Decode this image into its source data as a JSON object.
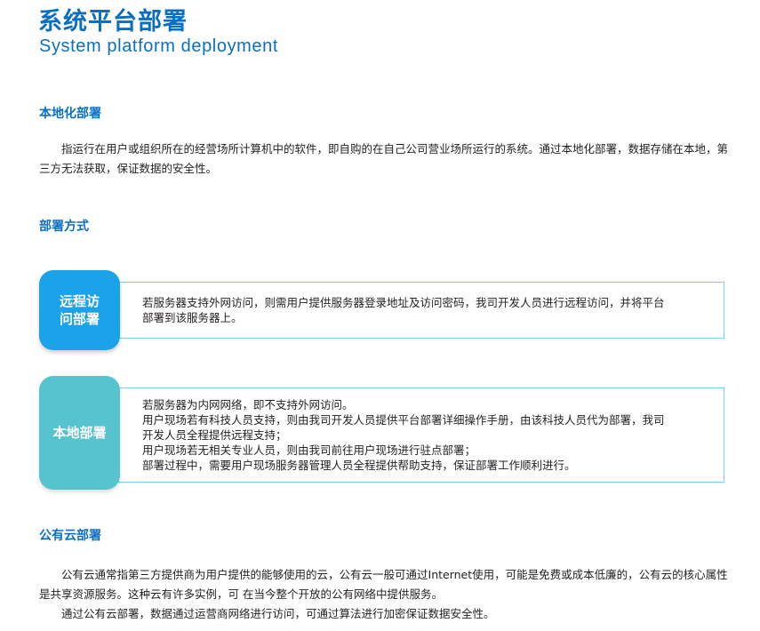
{
  "page": {
    "title": "系统平台部署",
    "subtitle": "System platform deployment"
  },
  "local": {
    "heading": "本地化部署",
    "paragraph": "指运行在用户或组织所在的经营场所计算机中的软件，即自购的在自己公司营业场所运行的系统。通过本地化部署，数据存储在本地，第三方无法获取，保证数据的安全性。"
  },
  "methods": {
    "heading": "部署方式",
    "remote": {
      "badge_line1": "远程访",
      "badge_line2": "问部署",
      "lines": [
        "若服务器支持外网访问，则需用户提供服务器登录地址及访问密码，我司开发人员进行远程访问，并将平台",
        "部署到该服务器上。"
      ]
    },
    "onsite": {
      "badge": "本地部署",
      "lines": [
        "若服务器为内网网络，即不支持外网访问。",
        "用户现场若有科技人员支持，则由我司开发人员提供平台部署详细操作手册，由该科技人员代为部署，我司",
        "开发人员全程提供远程支持；",
        "用户现场若无相关专业人员，则由我司前往用户现场进行驻点部署；",
        "部署过程中，需要用户现场服务器管理人员全程提供帮助支持，保证部署工作顺利进行。"
      ]
    }
  },
  "cloud": {
    "heading": "公有云部署",
    "paragraph1": "公有云通常指第三方提供商为用户提供的能够使用的云，公有云一般可通过Internet使用，可能是免费或成本低廉的，公有云的核心属性是共享资源服务。这种云有许多实例，可 在当今整个开放的公有网络中提供服务。",
    "paragraph2": "通过公有云部署，数据通过运营商网络进行访问，可通过算法进行加密保证数据安全性。"
  }
}
